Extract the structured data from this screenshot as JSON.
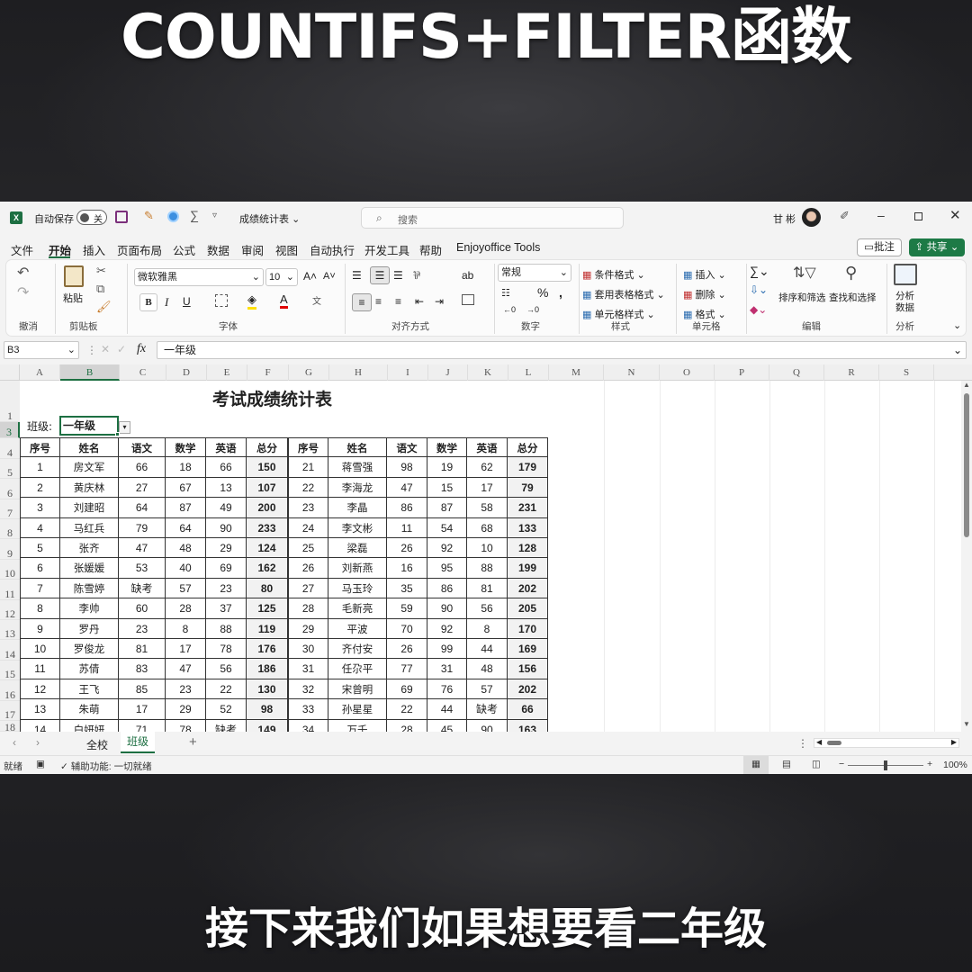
{
  "captions": {
    "top": "COUNTIFS+FILTER函数",
    "bottom": "接下来我们如果想要看二年级"
  },
  "titlebar": {
    "autosave_label": "自动保存",
    "autosave_state": "关",
    "file_name": "成绩统计表",
    "search_placeholder": "搜索",
    "user_name": "甘 彬"
  },
  "menu": [
    "文件",
    "开始",
    "插入",
    "页面布局",
    "公式",
    "数据",
    "审阅",
    "视图",
    "自动执行",
    "开发工具",
    "帮助",
    "Enjoyoffice Tools"
  ],
  "menu_active": "开始",
  "comment_btn": "批注",
  "share_btn": "共享",
  "ribbon": {
    "undo_group": "撤消",
    "clipboard": {
      "paste": "粘贴",
      "label": "剪贴板"
    },
    "font": {
      "name": "微软雅黑",
      "size": "10",
      "label": "字体",
      "bold": "B",
      "italic": "I",
      "underline": "U"
    },
    "align": {
      "label": "对齐方式"
    },
    "number": {
      "format": "常规",
      "label": "数字",
      "percent": "%"
    },
    "styles": {
      "cond": "条件格式",
      "table": "套用表格格式",
      "cell": "单元格样式",
      "label": "样式"
    },
    "cells": {
      "insert": "插入",
      "delete": "删除",
      "format": "格式",
      "label": "单元格"
    },
    "editing": {
      "sort": "排序和筛选",
      "find": "查找和选择",
      "label": "编辑"
    },
    "analysis": {
      "btn1": "分析",
      "btn2": "数据",
      "label": "分析"
    }
  },
  "formula_bar": {
    "name_box": "B3",
    "fx": "fx",
    "content": "一年级"
  },
  "columns": [
    "A",
    "B",
    "C",
    "D",
    "E",
    "F",
    "G",
    "H",
    "I",
    "J",
    "K",
    "L",
    "M",
    "N",
    "O",
    "P",
    "Q",
    "R",
    "S"
  ],
  "row_numbers": [
    "1",
    "3",
    "4",
    "5",
    "6",
    "7",
    "8",
    "9",
    "10",
    "11",
    "12",
    "13",
    "14",
    "15",
    "16",
    "17",
    "18"
  ],
  "sheet": {
    "title": "考试成绩统计表",
    "class_label": "班级:",
    "class_value": "一年级",
    "headers": [
      "序号",
      "姓名",
      "语文",
      "数学",
      "英语",
      "总分",
      "序号",
      "姓名",
      "语文",
      "数学",
      "英语",
      "总分"
    ],
    "rows": [
      [
        "1",
        "房文军",
        "66",
        "18",
        "66",
        "150",
        "21",
        "蒋雪强",
        "98",
        "19",
        "62",
        "179"
      ],
      [
        "2",
        "黄庆林",
        "27",
        "67",
        "13",
        "107",
        "22",
        "李海龙",
        "47",
        "15",
        "17",
        "79"
      ],
      [
        "3",
        "刘建昭",
        "64",
        "87",
        "49",
        "200",
        "23",
        "李晶",
        "86",
        "87",
        "58",
        "231"
      ],
      [
        "4",
        "马红兵",
        "79",
        "64",
        "90",
        "233",
        "24",
        "李文彬",
        "11",
        "54",
        "68",
        "133"
      ],
      [
        "5",
        "张齐",
        "47",
        "48",
        "29",
        "124",
        "25",
        "梁磊",
        "26",
        "92",
        "10",
        "128"
      ],
      [
        "6",
        "张媛媛",
        "53",
        "40",
        "69",
        "162",
        "26",
        "刘新燕",
        "16",
        "95",
        "88",
        "199"
      ],
      [
        "7",
        "陈雪婷",
        "缺考",
        "57",
        "23",
        "80",
        "27",
        "马玉玲",
        "35",
        "86",
        "81",
        "202"
      ],
      [
        "8",
        "李帅",
        "60",
        "28",
        "37",
        "125",
        "28",
        "毛新亮",
        "59",
        "90",
        "56",
        "205"
      ],
      [
        "9",
        "罗丹",
        "23",
        "8",
        "88",
        "119",
        "29",
        "平波",
        "70",
        "92",
        "8",
        "170"
      ],
      [
        "10",
        "罗俊龙",
        "81",
        "17",
        "78",
        "176",
        "30",
        "齐付安",
        "26",
        "99",
        "44",
        "169"
      ],
      [
        "11",
        "苏倩",
        "83",
        "47",
        "56",
        "186",
        "31",
        "任尕平",
        "77",
        "31",
        "48",
        "156"
      ],
      [
        "12",
        "王飞",
        "85",
        "23",
        "22",
        "130",
        "32",
        "宋曾明",
        "69",
        "76",
        "57",
        "202"
      ],
      [
        "13",
        "朱萌",
        "17",
        "29",
        "52",
        "98",
        "33",
        "孙星星",
        "22",
        "44",
        "缺考",
        "66"
      ],
      [
        "14",
        "白妍妍",
        "71",
        "78",
        "缺考",
        "149",
        "34",
        "万千",
        "28",
        "45",
        "90",
        "163"
      ]
    ]
  },
  "tabs": {
    "items": [
      "全校",
      "班级"
    ],
    "active": "班级"
  },
  "status": {
    "ready": "就绪",
    "accessibility": "辅助功能: 一切就绪",
    "zoom": "100%"
  }
}
